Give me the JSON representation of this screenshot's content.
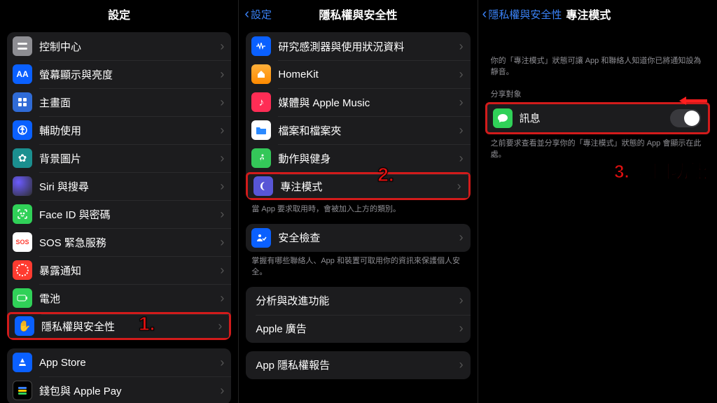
{
  "panel1": {
    "title": "設定",
    "rows": {
      "controlCenter": "控制中心",
      "display": "螢幕顯示與亮度",
      "home": "主畫面",
      "accessibility": "輔助使用",
      "wallpaper": "背景圖片",
      "siri": "Siri 與搜尋",
      "faceid": "Face ID 與密碼",
      "sos": "SOS 緊急服務",
      "exposure": "暴露通知",
      "battery": "電池",
      "privacy": "隱私權與安全性",
      "appstore": "App Store",
      "wallet": "錢包與 Apple Pay"
    },
    "step": "1."
  },
  "panel2": {
    "back": "設定",
    "title": "隱私權與安全性",
    "rows": {
      "research": "研究感測器與使用狀況資料",
      "homekit": "HomeKit",
      "media": "媒體與 Apple Music",
      "files": "檔案和檔案夾",
      "fitness": "動作與健身",
      "focus": "專注模式",
      "safety": "安全檢查",
      "analytics": "分析與改進功能",
      "ads": "Apple 廣告",
      "report": "App 隱私權報告"
    },
    "footer1": "當 App 要求取用時，會被加入上方的類別。",
    "footer2": "掌握有哪些聯絡人、App 和裝置可取用你的資訊來保護個人安全。",
    "step": "2."
  },
  "panel3": {
    "back": "隱私權與安全性",
    "title": "專注模式",
    "intro": "你的「專注模式」狀態可讓 App 和聯絡人知道你已將通知設為靜音。",
    "section": "分享對象",
    "messages": "訊息",
    "footer": "之前要求查看並分享你的「專注模式」狀態的 App 會顯示在此處。",
    "step": "3. 關閉功能"
  }
}
